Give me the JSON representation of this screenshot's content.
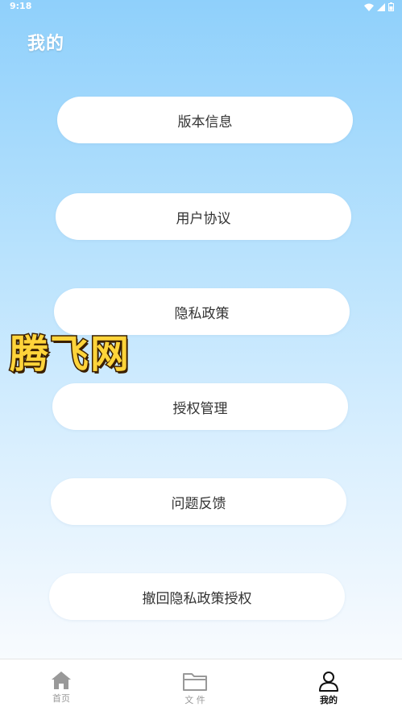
{
  "status_bar": {
    "time": "9:18"
  },
  "header": {
    "title": "我的"
  },
  "menu": [
    {
      "label": "版本信息"
    },
    {
      "label": "用户协议"
    },
    {
      "label": "隐私政策"
    },
    {
      "label": "授权管理"
    },
    {
      "label": "问题反馈"
    },
    {
      "label": "撤回隐私政策授权"
    }
  ],
  "watermark": {
    "text": "腾飞网"
  },
  "tab_bar": {
    "tabs": [
      {
        "label": "首页",
        "icon": "home-icon",
        "active": false
      },
      {
        "label": "文 件",
        "icon": "folder-icon",
        "active": false
      },
      {
        "label": "我的",
        "icon": "person-icon",
        "active": true
      }
    ]
  },
  "colors": {
    "active_tab": "#111111",
    "inactive_tab": "#999999",
    "bg_top": "#8fd0fb",
    "bg_bottom": "#ffffff"
  }
}
